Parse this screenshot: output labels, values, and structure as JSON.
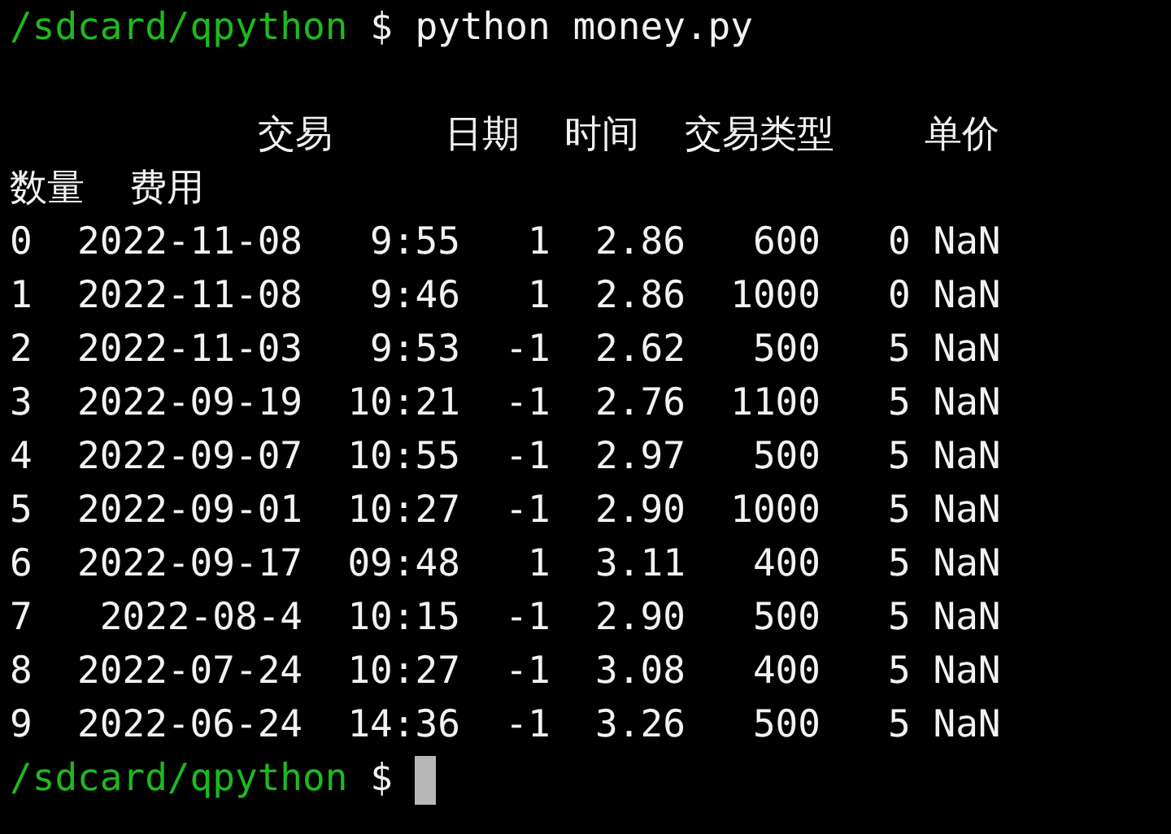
{
  "terminal": {
    "lines": [
      {
        "kind": "prompt",
        "path": "/sdcard/qpython",
        "symbol": "$",
        "command": "python money.py",
        "cursor": false
      },
      {
        "kind": "blank"
      },
      {
        "kind": "output",
        "text": "           交易     日期  时间  交易类型    单价"
      },
      {
        "kind": "output",
        "text": "数量  费用"
      },
      {
        "kind": "output",
        "text": "0  2022-11-08   9:55   1  2.86   600   0 NaN"
      },
      {
        "kind": "output",
        "text": "1  2022-11-08   9:46   1  2.86  1000   0 NaN"
      },
      {
        "kind": "output",
        "text": "2  2022-11-03   9:53  -1  2.62   500   5 NaN"
      },
      {
        "kind": "output",
        "text": "3  2022-09-19  10:21  -1  2.76  1100   5 NaN"
      },
      {
        "kind": "output",
        "text": "4  2022-09-07  10:55  -1  2.97   500   5 NaN"
      },
      {
        "kind": "output",
        "text": "5  2022-09-01  10:27  -1  2.90  1000   5 NaN"
      },
      {
        "kind": "output",
        "text": "6  2022-09-17  09:48   1  3.11   400   5 NaN"
      },
      {
        "kind": "output",
        "text": "7   2022-08-4  10:15  -1  2.90   500   5 NaN"
      },
      {
        "kind": "output",
        "text": "8  2022-07-24  10:27  -1  3.08   400   5 NaN"
      },
      {
        "kind": "output",
        "text": "9  2022-06-24  14:36  -1  3.26   500   5 NaN"
      },
      {
        "kind": "prompt",
        "path": "/sdcard/qpython",
        "symbol": "$",
        "cursor": true
      }
    ]
  }
}
